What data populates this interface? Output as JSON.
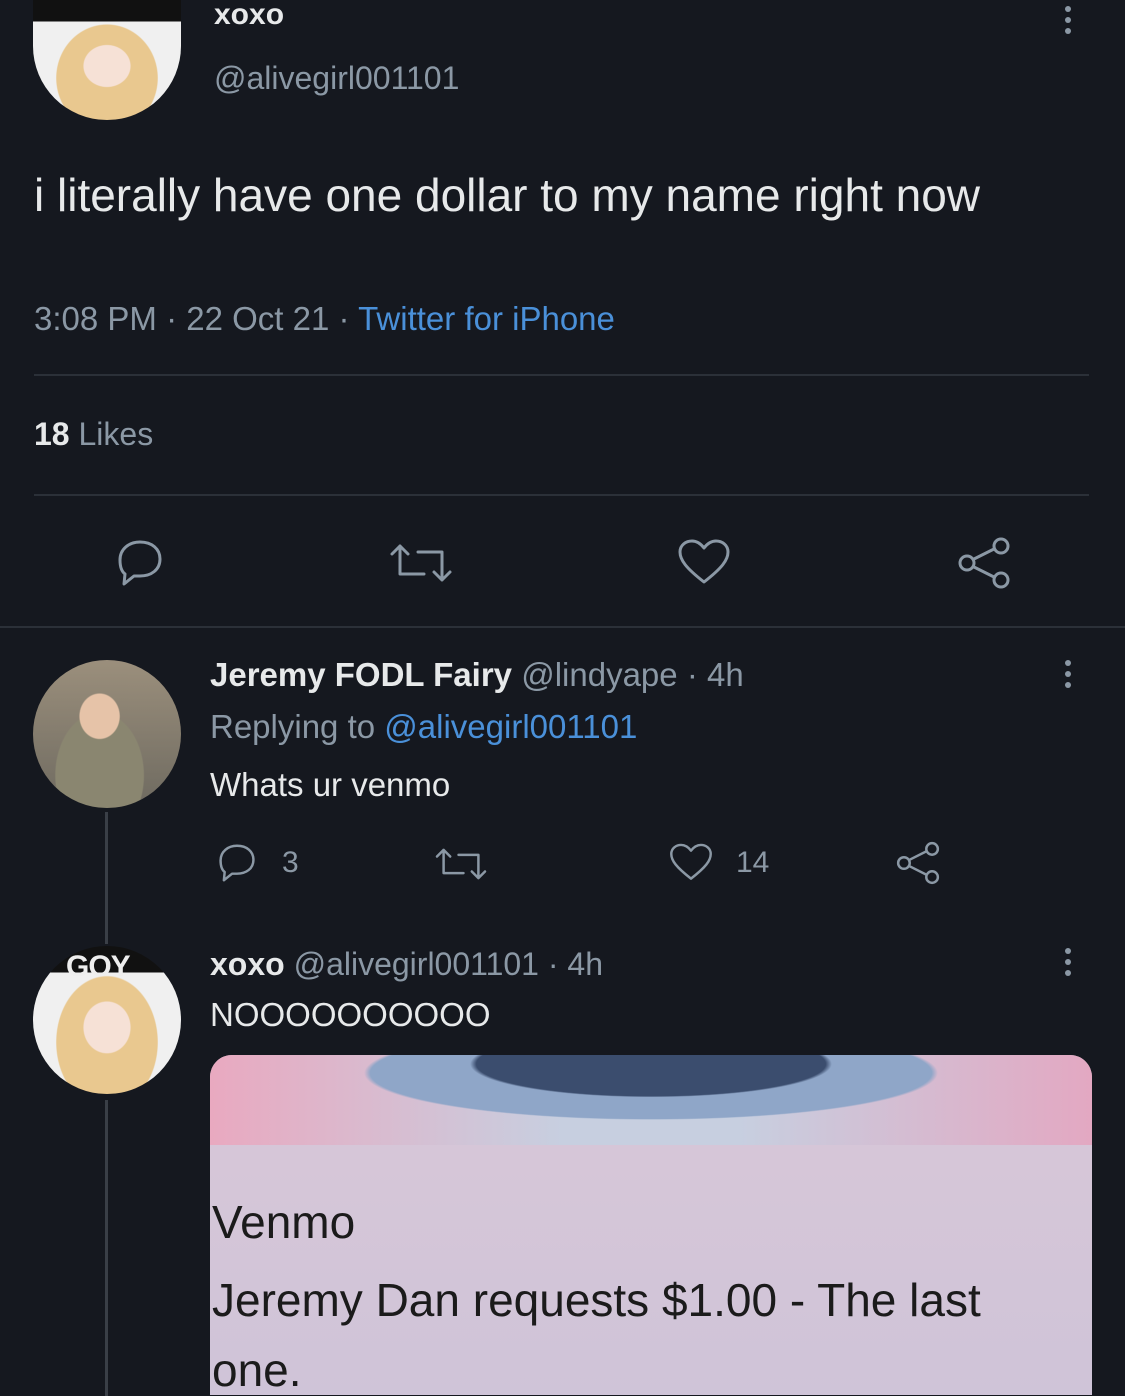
{
  "main_tweet": {
    "display_name": "xoxo",
    "handle": "@alivegirl001101",
    "text": "i literally have one dollar to my name right now",
    "time": "3:08 PM",
    "date": "22 Oct 21",
    "client": "Twitter for iPhone",
    "likes_count": "18",
    "likes_label": "Likes"
  },
  "reply1": {
    "display_name": "Jeremy FODL Fairy",
    "handle": "@lindyape",
    "age": "4h",
    "replying_label": "Replying to",
    "replying_handle": "@alivegirl001101",
    "text": "Whats ur venmo",
    "reply_count": "3",
    "like_count": "14"
  },
  "reply2": {
    "display_name": "xoxo",
    "handle": "@alivegirl001101",
    "age": "4h",
    "text": "NOOOOOOOOOO",
    "avatar_hat_text": "GOY",
    "card": {
      "title": "Venmo",
      "body": "Jeremy Dan requests $1.00 - The last one."
    }
  },
  "separator": "·",
  "colors": {
    "background": "#15181f",
    "text": "#e7e9ea",
    "muted": "#8b98a5",
    "link": "#4a90d9"
  }
}
